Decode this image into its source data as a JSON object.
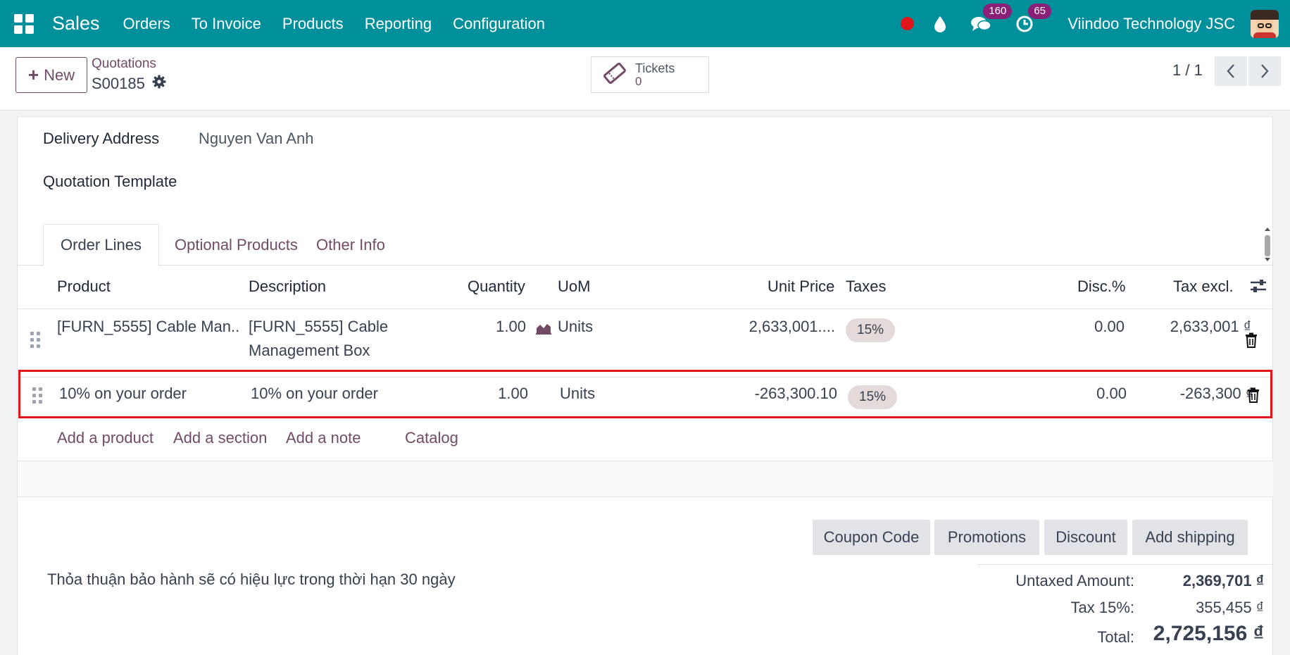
{
  "navbar": {
    "brand": "Sales",
    "menu": [
      "Orders",
      "To Invoice",
      "Products",
      "Reporting",
      "Configuration"
    ],
    "messages_count": "160",
    "activities_count": "65",
    "company": "Viindoo Technology JSC",
    "bg_color": "#00909b",
    "badge_color": "#8a1f78"
  },
  "control": {
    "new_label": "New",
    "breadcrumb": "Quotations",
    "record": "S00185",
    "smart_label": "Tickets",
    "smart_value": "0",
    "pager": "1 / 1"
  },
  "form": {
    "delivery_label": "Delivery Address",
    "delivery_value": "Nguyen Van Anh",
    "template_label": "Quotation Template"
  },
  "tabs": [
    "Order Lines",
    "Optional Products",
    "Other Info"
  ],
  "columns": {
    "product": "Product",
    "description": "Description",
    "quantity": "Quantity",
    "uom": "UoM",
    "unit_price": "Unit Price",
    "taxes": "Taxes",
    "discount": "Disc.%",
    "subtotal": "Tax excl."
  },
  "lines": [
    {
      "product": "[FURN_5555] Cable Man...",
      "description_1": "[FURN_5555] Cable",
      "description_2": "Management Box",
      "quantity": "1.00",
      "uom": "Units",
      "unit_price": "2,633,001....",
      "tax": "15%",
      "discount": "0.00",
      "subtotal": "2,633,001 ₫"
    },
    {
      "product": "10% on your order",
      "description_1": "10% on your order",
      "quantity": "1.00",
      "uom": "Units",
      "unit_price": "-263,300.10",
      "tax": "15%",
      "discount": "0.00",
      "subtotal": "-263,300 ₫"
    }
  ],
  "add_links": [
    "Add a product",
    "Add a section",
    "Add a note",
    "Catalog"
  ],
  "promo_buttons": [
    "Coupon Code",
    "Promotions",
    "Discount",
    "Add shipping"
  ],
  "note": "Thỏa thuận bảo hành sẽ có hiệu lực trong thời hạn 30 ngày",
  "totals": {
    "untaxed_label": "Untaxed Amount:",
    "untaxed_value": "2,369,701 ₫",
    "tax_label": "Tax 15%:",
    "tax_value": "355,455 ₫",
    "total_label": "Total:",
    "total_value": "2,725,156 ₫"
  },
  "colors": {
    "accent": "#714b67",
    "highlight_border": "#e0161b",
    "recording_dot": "#e0161b"
  }
}
